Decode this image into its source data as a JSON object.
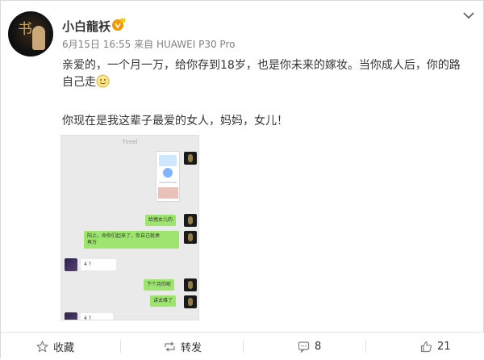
{
  "post": {
    "username": "小白龍袄",
    "date": "6月15日 16:55",
    "source": "来自 HUAWEI P30 Pro",
    "text_line1": "亲爱的，一个月一万，给你存到18岁，也是你未来的嫁妆。当你成人后，你的路",
    "text_line1_end": "自己走",
    "text_line2": "你现在是我这辈子最爱的女人，妈妈，女儿！"
  },
  "screenshot": {
    "title": "Tireel",
    "messages": [
      {
        "side": "right",
        "text": "给拽女儿的"
      },
      {
        "side": "right",
        "text": "阳上，命你们起来了，你自己就承\n再万"
      },
      {
        "side": "left",
        "text": "4 ?"
      },
      {
        "side": "right",
        "text": "下个月的呢"
      },
      {
        "side": "right",
        "text": "讲太难了"
      },
      {
        "side": "left",
        "text": "4 ?"
      }
    ]
  },
  "footer": {
    "favorite_label": "收藏",
    "repost_label": "转发",
    "comment_count": "8",
    "like_count": "21"
  },
  "icons": {
    "vip": "vip-badge-icon",
    "dropdown": "chevron-down-icon",
    "emoji": "smile-emoji-icon",
    "favorite": "star-icon",
    "repost": "repost-icon",
    "comment": "comment-icon",
    "like": "thumbs-up-icon"
  },
  "colors": {
    "accent_orange": "#f39800",
    "chat_green": "#9ee56f"
  }
}
